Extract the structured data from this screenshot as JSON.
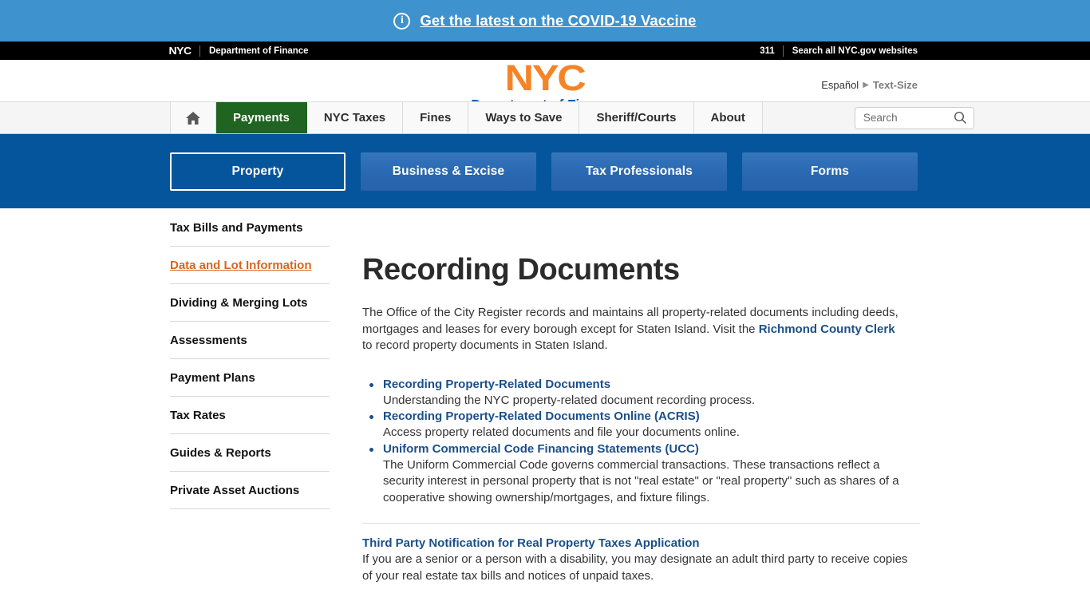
{
  "covid_banner": {
    "icon": "info-circle-icon",
    "link_text": "Get the latest on the COVID-19 Vaccine"
  },
  "utility_bar": {
    "nyc_mark": "NYC",
    "agency": "Department of Finance",
    "phone_311": "311",
    "search_all": "Search all NYC.gov websites"
  },
  "logo": {
    "nyc": "NYC",
    "agency": "Department of Finance"
  },
  "language": {
    "espanol": "Español",
    "caret": "▶",
    "text_size": "Text-Size"
  },
  "main_nav": {
    "home_icon": "home-icon",
    "items": [
      {
        "label": "Payments",
        "active": true
      },
      {
        "label": "NYC Taxes",
        "active": false
      },
      {
        "label": "Fines",
        "active": false
      },
      {
        "label": "Ways to Save",
        "active": false
      },
      {
        "label": "Sheriff/Courts",
        "active": false
      },
      {
        "label": "About",
        "active": false
      }
    ],
    "active_color": "#1f6420"
  },
  "search": {
    "placeholder": "Search",
    "value": "",
    "icon": "magnifier-icon"
  },
  "subnav": {
    "background": "#05559c",
    "tabs": [
      {
        "label": "Property",
        "selected": true
      },
      {
        "label": "Business & Excise",
        "selected": false
      },
      {
        "label": "Tax Professionals",
        "selected": false
      },
      {
        "label": "Forms",
        "selected": false
      }
    ]
  },
  "sidebar": {
    "items": [
      {
        "label": "Tax Bills and Payments",
        "active": false
      },
      {
        "label": "Data and Lot Information",
        "active": true
      },
      {
        "label": "Dividing & Merging Lots",
        "active": false
      },
      {
        "label": "Assessments",
        "active": false
      },
      {
        "label": "Payment Plans",
        "active": false
      },
      {
        "label": "Tax Rates",
        "active": false
      },
      {
        "label": "Guides & Reports",
        "active": false
      },
      {
        "label": "Private Asset Auctions",
        "active": false
      }
    ],
    "active_color": "#d9661f"
  },
  "main": {
    "title": "Recording Documents",
    "intro_part1": "The Office of the City Register records and maintains all property-related documents including deeds, mortgages and leases for every borough except for Staten Island. Visit the ",
    "intro_link": "Richmond County Clerk",
    "intro_part2": " to record property documents in Staten Island.",
    "doc_items": [
      {
        "link": "Recording Property-Related Documents",
        "desc": "Understanding the NYC property-related document recording process."
      },
      {
        "link": "Recording Property-Related Documents Online (ACRIS)",
        "desc": "Access property related documents and file your documents online."
      },
      {
        "link": "Uniform Commercial Code Financing Statements (UCC)",
        "desc": "The Uniform Commercial Code governs commercial transactions. These transactions reflect a security interest in personal property that is not \"real estate\" or \"real property\" such as shares of a cooperative showing ownership/mortgages, and fixture filings."
      }
    ],
    "bottom_link": "Third Party Notification for Real Property Taxes Application",
    "bottom_desc": "If you are a senior or a person with a disability, you may designate an adult third party to receive copies of your real estate tax bills and notices of unpaid taxes."
  }
}
